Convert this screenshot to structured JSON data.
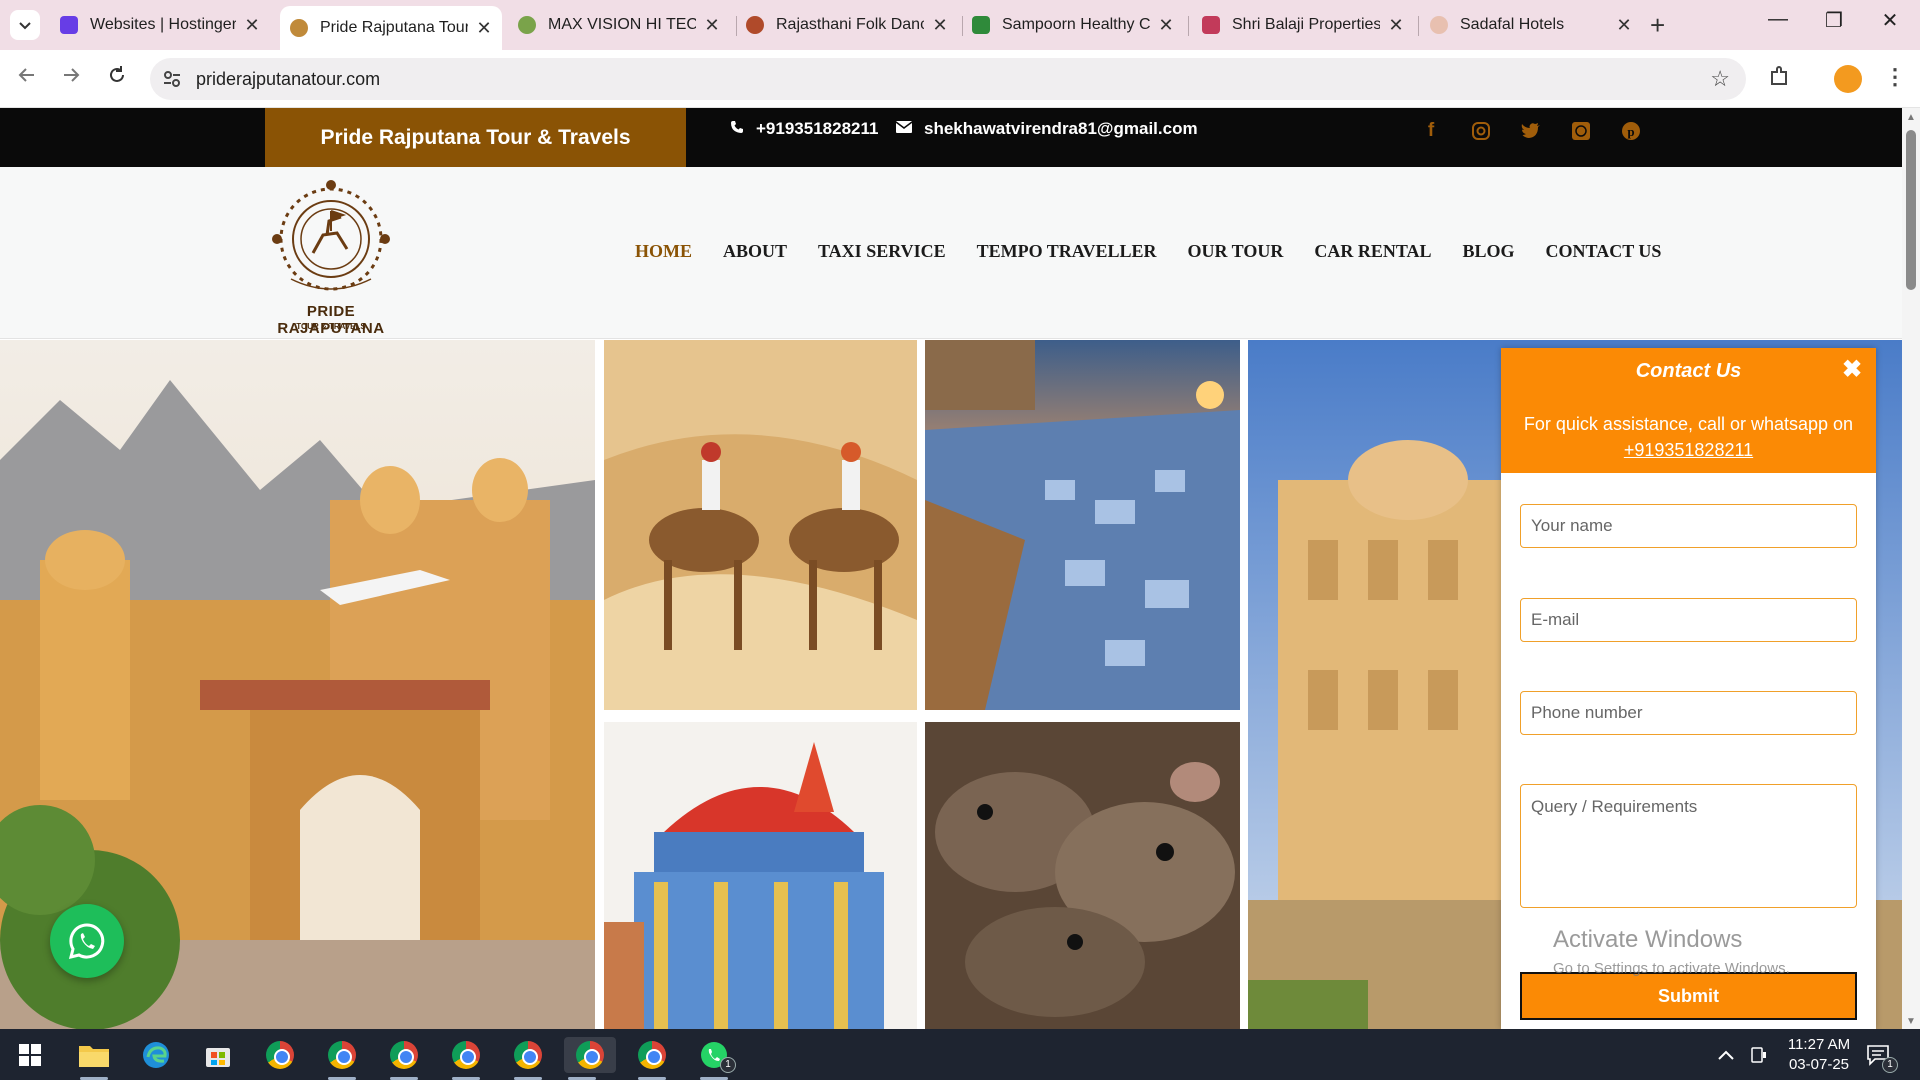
{
  "browser": {
    "tabs": [
      {
        "title": "Websites | Hostinger",
        "favicon_color": "#673de6"
      },
      {
        "title": "Pride Rajputana Tour",
        "favicon_color": "#c08a3a",
        "active": true
      },
      {
        "title": "MAX VISION HI TECH",
        "favicon_color": "#7aa34a"
      },
      {
        "title": "Rajasthani Folk Danc",
        "favicon_color": "#b04a2a"
      },
      {
        "title": "Sampoorn Healthy Cl",
        "favicon_color": "#2f8a3a"
      },
      {
        "title": "Shri Balaji Properties",
        "favicon_color": "#c23a5a"
      },
      {
        "title": "Sadafal Hotels",
        "favicon_color": "#e8c0b0"
      }
    ],
    "close_glyph": "✕",
    "new_tab_glyph": "+",
    "window_controls": [
      "—",
      "❐",
      "✕"
    ],
    "url": "priderajputanatour.com"
  },
  "site": {
    "brand": "Pride Rajputana Tour & Travels",
    "phone": "+919351828211",
    "email": "shekhawatvirendra81@gmail.com",
    "socials": [
      "facebook-icon",
      "instagram-icon",
      "twitter-icon",
      "whatsapp-icon",
      "pinterest-icon"
    ],
    "logo_text": "PRIDE RAJAPUTANA",
    "logo_subtext": "TOUR & TRAVELS",
    "nav": [
      "HOME",
      "ABOUT",
      "TAXI SERVICE",
      "TEMPO TRAVELLER",
      "OUR TOUR",
      "CAR RENTAL",
      "BLOG",
      "CONTACT US"
    ],
    "active_nav": "HOME",
    "accent": "#8a5305"
  },
  "contact_widget": {
    "title": "Contact Us",
    "close_glyph": "✖",
    "subtitle": "For quick assistance, call or whatsapp on",
    "phone": "+919351828211",
    "placeholders": {
      "name": "Your name",
      "email": "E-mail",
      "phone": "Phone number",
      "query": "Query / Requirements"
    },
    "submit": "Submit",
    "accent": "#fb8a05"
  },
  "watermark": {
    "line1": "Activate Windows",
    "line2": "Go to Settings to activate Windows."
  },
  "taskbar": {
    "time": "11:27 AM",
    "date": "03-07-25",
    "whatsapp_badge": "1",
    "notification_badge": "1"
  }
}
